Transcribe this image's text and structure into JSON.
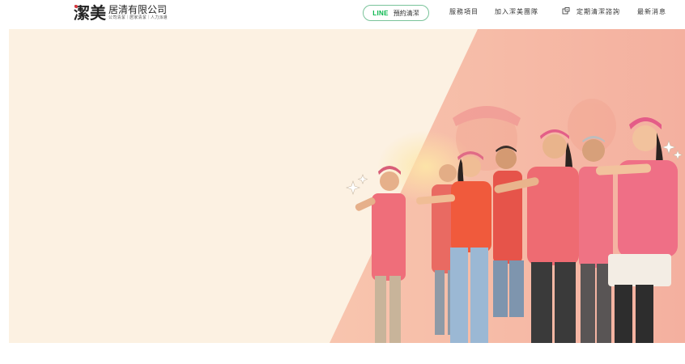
{
  "header": {
    "logo_mark": "潔美",
    "logo_name": "居清有限公司",
    "logo_sub": "公司清潔｜居家清潔｜人力派遣",
    "line_brand": "LINE",
    "line_label": "預約清潔",
    "nav": [
      {
        "label": "服務項目"
      },
      {
        "label": "加入潔美團隊"
      },
      {
        "label": "定期清潔諮詢"
      },
      {
        "label": "最新消息"
      }
    ]
  },
  "hero": {
    "background_color": "#fcf1e2",
    "accent_color": "#f6b8a1",
    "shirt_color": "#ef6e62"
  },
  "colors": {
    "line_green": "#06b64b",
    "line_border": "#7ac39a",
    "logo_red": "#d9363e"
  }
}
